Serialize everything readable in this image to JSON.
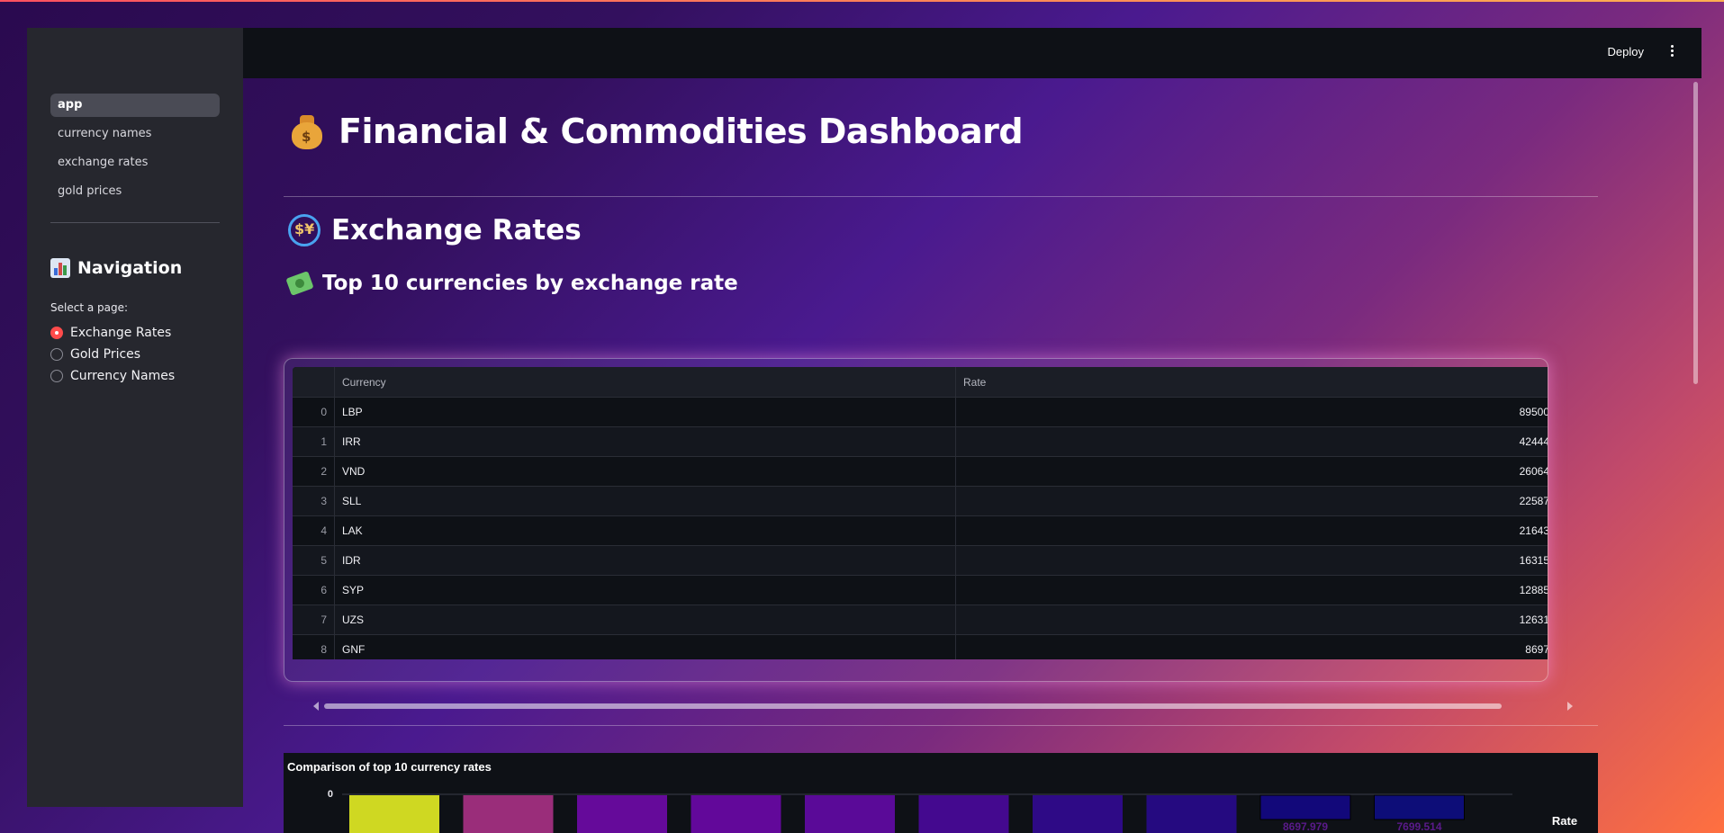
{
  "header": {
    "deploy_label": "Deploy",
    "menu_icon": "kebab-menu-icon"
  },
  "sidebar": {
    "pages": [
      {
        "label": "app",
        "active": true
      },
      {
        "label": "currency names",
        "active": false
      },
      {
        "label": "exchange rates",
        "active": false
      },
      {
        "label": "gold prices",
        "active": false
      }
    ],
    "nav_title": "Navigation",
    "nav_icon": "bar-chart-icon",
    "select_label": "Select a page:",
    "options": [
      {
        "label": "Exchange Rates",
        "selected": true
      },
      {
        "label": "Gold Prices",
        "selected": false
      },
      {
        "label": "Currency Names",
        "selected": false
      }
    ]
  },
  "main": {
    "title": "Financial & Commodities Dashboard",
    "title_icon": "money-bag-icon",
    "section_title": "Exchange Rates",
    "section_icon": "currency-exchange-icon",
    "subsection_title": "Top 10 currencies by exchange rate",
    "subsection_icon": "money-with-wings-icon"
  },
  "table": {
    "columns": [
      "",
      "Currency",
      "Rate"
    ],
    "rows": [
      {
        "index": "0",
        "currency": "LBP",
        "rate": "89500"
      },
      {
        "index": "1",
        "currency": "IRR",
        "rate": "42444"
      },
      {
        "index": "2",
        "currency": "VND",
        "rate": "26064"
      },
      {
        "index": "3",
        "currency": "SLL",
        "rate": "22587"
      },
      {
        "index": "4",
        "currency": "LAK",
        "rate": "21643"
      },
      {
        "index": "5",
        "currency": "IDR",
        "rate": "16315"
      },
      {
        "index": "6",
        "currency": "SYP",
        "rate": "12885"
      },
      {
        "index": "7",
        "currency": "UZS",
        "rate": "12631"
      },
      {
        "index": "8",
        "currency": "GNF",
        "rate": "8697"
      }
    ]
  },
  "chart_data": {
    "type": "bar",
    "title": "Comparison of top 10 currency rates",
    "y_tick_labels": [
      "0"
    ],
    "legend_title": "Rate",
    "data_labels": [
      "8697.979",
      "7699.514"
    ],
    "bar_colors": [
      "#cfd822",
      "#9a2d7a",
      "#650a9a",
      "#62089a",
      "#5a0a98",
      "#44098f",
      "#2e0a86",
      "#250a80",
      "#12087a",
      "#0d0d78"
    ],
    "data_label_color": "#5a1a8a"
  }
}
